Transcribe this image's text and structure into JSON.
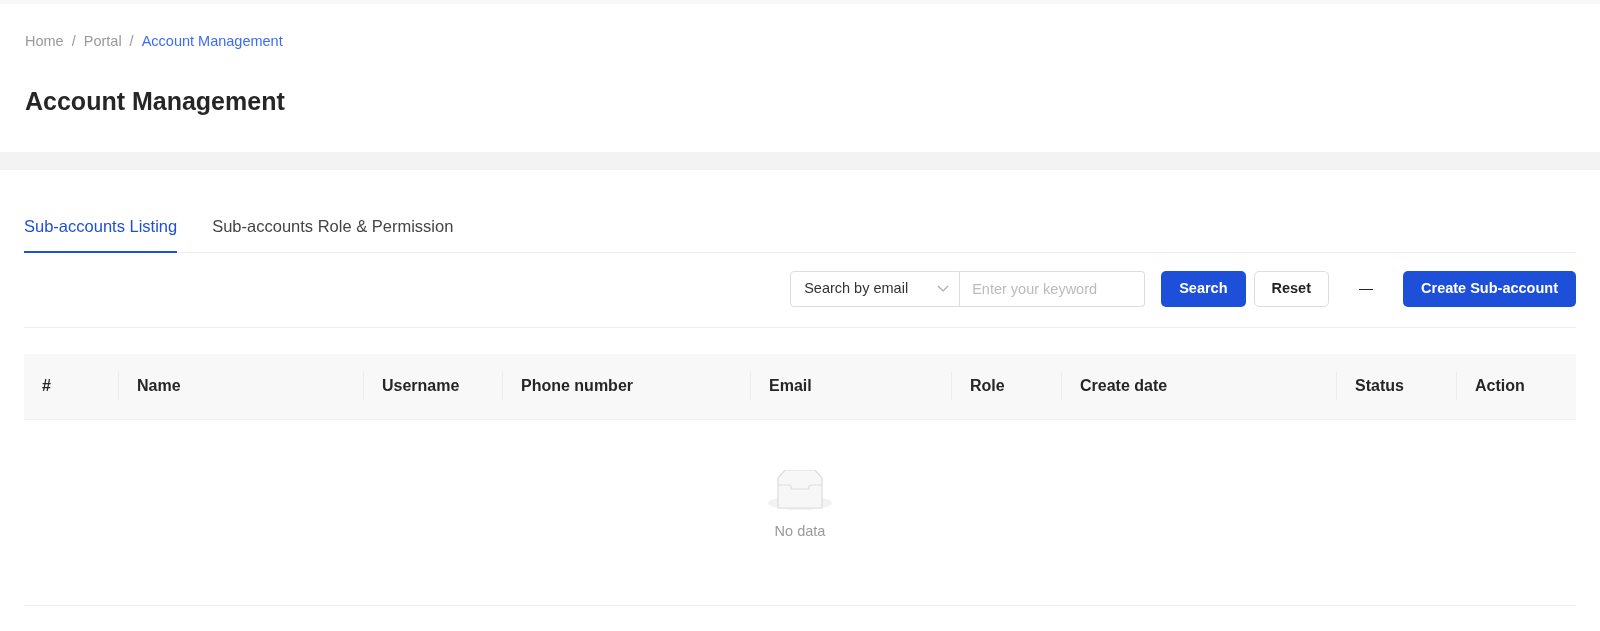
{
  "breadcrumb": [
    {
      "label": "Home",
      "selected": false
    },
    {
      "label": "Portal",
      "selected": false
    },
    {
      "label": "Account Management",
      "selected": true
    }
  ],
  "breadcrumb_separator": "/",
  "title": "Account Management",
  "tabs": [
    {
      "label": "Sub-accounts Listing",
      "selected": true
    },
    {
      "label": "Sub-accounts Role & Permission",
      "selected": false
    }
  ],
  "toolbar": {
    "search_type": "Search by email",
    "keyword": {
      "placeholder": "Enter your keyword"
    },
    "search_button": "Search",
    "reset_button": "Reset",
    "separator": "—",
    "create_button": "Create Sub-account"
  },
  "table": {
    "columns": [
      "#",
      "Name",
      "Username",
      "Phone number",
      "Email",
      "Role",
      "Create date",
      "Status",
      "Action"
    ],
    "empty_text": "No data"
  }
}
